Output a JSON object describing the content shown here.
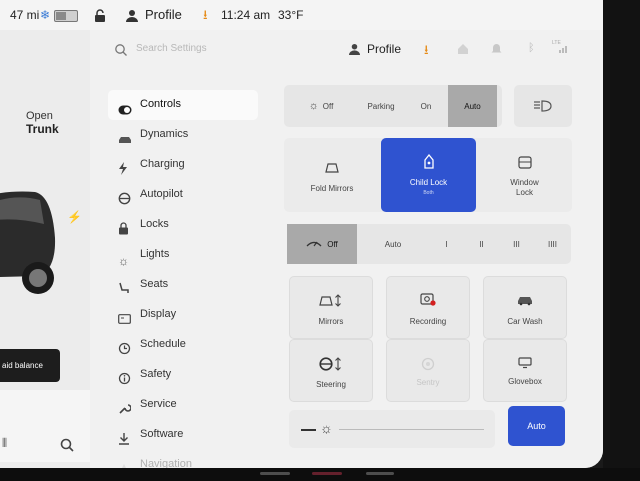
{
  "status_bar": {
    "range": "47 mi",
    "profile_label": "Profile",
    "time": "11:24 am",
    "temperature": "33°F"
  },
  "car_panel": {
    "trunk_line1": "Open",
    "trunk_line2": "Trunk",
    "balance_banner": "aid balance"
  },
  "search": {
    "placeholder": "Search Settings"
  },
  "header": {
    "profile_label": "Profile",
    "signal_badge": "LTE"
  },
  "sidebar": {
    "items": [
      {
        "label": "Controls",
        "icon": "toggle-icon",
        "active": true
      },
      {
        "label": "Dynamics",
        "icon": "car-icon"
      },
      {
        "label": "Charging",
        "icon": "bolt-icon"
      },
      {
        "label": "Autopilot",
        "icon": "steering-wheel-icon"
      },
      {
        "label": "Locks",
        "icon": "lock-icon"
      },
      {
        "label": "Lights",
        "icon": "sun-icon"
      },
      {
        "label": "Seats",
        "icon": "seat-icon"
      },
      {
        "label": "Display",
        "icon": "display-icon"
      },
      {
        "label": "Schedule",
        "icon": "clock-icon"
      },
      {
        "label": "Safety",
        "icon": "info-icon"
      },
      {
        "label": "Service",
        "icon": "wrench-icon"
      },
      {
        "label": "Software",
        "icon": "download-icon"
      },
      {
        "label": "Navigation",
        "icon": "navigation-icon"
      }
    ]
  },
  "headlights": {
    "options": [
      "Off",
      "Parking",
      "On",
      "Auto"
    ],
    "selected": "Auto"
  },
  "fold_mirrors": {
    "label": "Fold Mirrors"
  },
  "child_lock": {
    "label": "Child Lock",
    "sub": "Both",
    "active_color": "#2f53d0"
  },
  "window_lock": {
    "label_line1": "Window",
    "label_line2": "Lock"
  },
  "wipers": {
    "options": [
      "Off",
      "Auto",
      "I",
      "II",
      "III",
      "IIII"
    ],
    "selected": "Off"
  },
  "tiles": {
    "mirrors": "Mirrors",
    "recording": "Recording",
    "car_wash": "Car Wash",
    "steering": "Steering",
    "sentry": "Sentry",
    "glovebox": "Glovebox"
  },
  "brightness": {
    "button_label": "Auto",
    "level": 0.05
  }
}
